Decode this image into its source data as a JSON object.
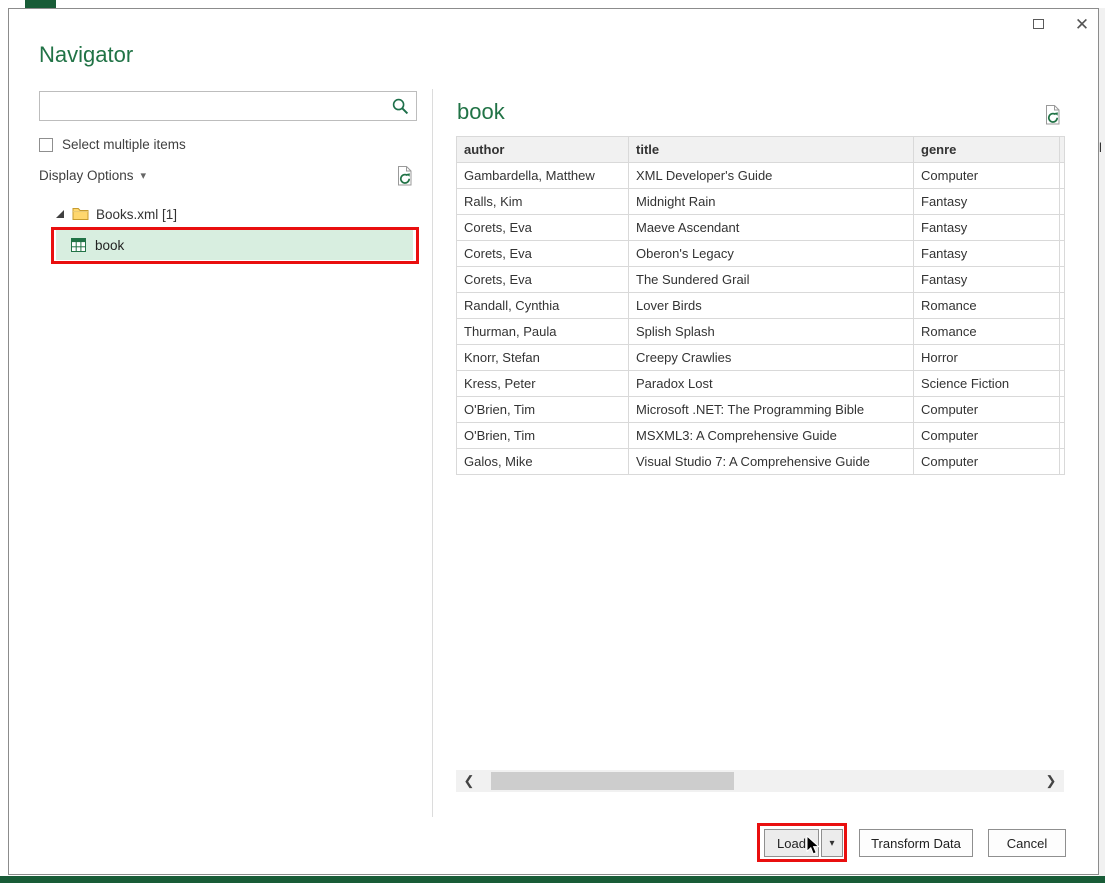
{
  "colors": {
    "accent_green": "#217346",
    "selection_green": "#d8eee0",
    "annotation_red": "#e90f0f",
    "excel_green": "#185c37",
    "table_header_bg": "#f1f1f1"
  },
  "window_controls": {
    "close_glyph": "✕"
  },
  "icons": {
    "caret_down": "▾",
    "scroll_left": "❮",
    "scroll_right": "❯"
  },
  "navigator": {
    "title": "Navigator",
    "search": {
      "value": "",
      "placeholder": ""
    },
    "select_multiple_label": "Select multiple items",
    "display_options_label": "Display Options",
    "tree": {
      "root_label": "Books.xml [1]",
      "items": [
        {
          "label": "book",
          "selected": true
        }
      ]
    }
  },
  "preview": {
    "title": "book",
    "table": {
      "columns": [
        "author",
        "title",
        "genre"
      ],
      "rows": [
        [
          "Gambardella, Matthew",
          "XML Developer's Guide",
          "Computer"
        ],
        [
          "Ralls, Kim",
          "Midnight Rain",
          "Fantasy"
        ],
        [
          "Corets, Eva",
          "Maeve Ascendant",
          "Fantasy"
        ],
        [
          "Corets, Eva",
          "Oberon's Legacy",
          "Fantasy"
        ],
        [
          "Corets, Eva",
          "The Sundered Grail",
          "Fantasy"
        ],
        [
          "Randall, Cynthia",
          "Lover Birds",
          "Romance"
        ],
        [
          "Thurman, Paula",
          "Splish Splash",
          "Romance"
        ],
        [
          "Knorr, Stefan",
          "Creepy Crawlies",
          "Horror"
        ],
        [
          "Kress, Peter",
          "Paradox Lost",
          "Science Fiction"
        ],
        [
          "O'Brien, Tim",
          "Microsoft .NET: The Programming Bible",
          "Computer"
        ],
        [
          "O'Brien, Tim",
          "MSXML3: A Comprehensive Guide",
          "Computer"
        ],
        [
          "Galos, Mike",
          "Visual Studio 7: A Comprehensive Guide",
          "Computer"
        ]
      ]
    }
  },
  "footer": {
    "load_label": "Load",
    "transform_data_label": "Transform Data",
    "cancel_label": "Cancel"
  },
  "background": {
    "clipped_text": "l"
  }
}
